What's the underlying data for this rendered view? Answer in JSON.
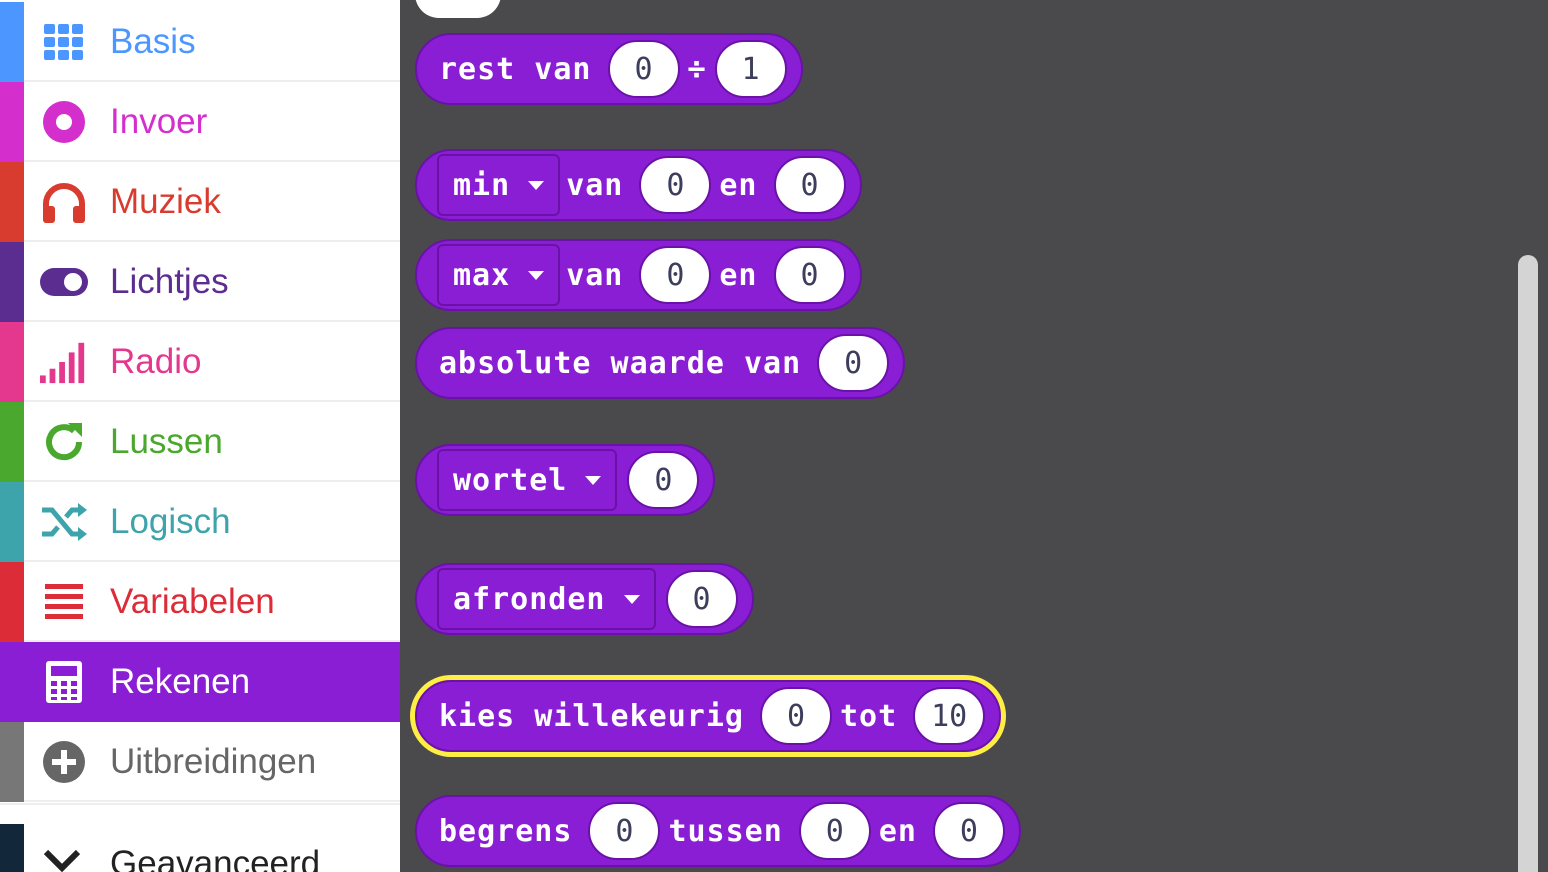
{
  "sidebar": {
    "items": [
      {
        "label": "Basis",
        "color": "#4c97ff",
        "icon": "grid-icon"
      },
      {
        "label": "Invoer",
        "color": "#d42fcd",
        "icon": "target-icon"
      },
      {
        "label": "Muziek",
        "color": "#d83c2f",
        "icon": "headphones-icon"
      },
      {
        "label": "Lichtjes",
        "color": "#5c2d91",
        "icon": "toggle-icon"
      },
      {
        "label": "Radio",
        "color": "#e3388e",
        "icon": "signal-bars-icon"
      },
      {
        "label": "Lussen",
        "color": "#4ba82e",
        "icon": "refresh-icon"
      },
      {
        "label": "Logisch",
        "color": "#3ea4ab",
        "icon": "shuffle-icon"
      },
      {
        "label": "Variabelen",
        "color": "#dc2c38",
        "icon": "list-lines-icon"
      },
      {
        "label": "Rekenen",
        "color": "#8a1ed4",
        "icon": "calculator-icon",
        "selected": true
      },
      {
        "label": "Uitbreidingen",
        "color": "#777777",
        "icon": "plus-circle-icon"
      }
    ],
    "advanced": {
      "label": "Geavanceerd",
      "icon": "chevron-down-icon"
    }
  },
  "blocks": {
    "rest": {
      "prefix": "rest van",
      "a": "0",
      "op": "÷",
      "b": "1"
    },
    "min": {
      "func": "min",
      "van": "van",
      "a": "0",
      "en": "en",
      "b": "0"
    },
    "max": {
      "func": "max",
      "van": "van",
      "a": "0",
      "en": "en",
      "b": "0"
    },
    "abs": {
      "text": "absolute waarde van",
      "a": "0"
    },
    "sqrt": {
      "func": "wortel",
      "a": "0"
    },
    "round": {
      "func": "afronden",
      "a": "0"
    },
    "random": {
      "prefix": "kies willekeurig",
      "a": "0",
      "tot": "tot",
      "b": "10"
    },
    "constrain": {
      "prefix": "begrens",
      "a": "0",
      "tussen": "tussen",
      "b": "0",
      "en": "en",
      "c": "0"
    }
  }
}
